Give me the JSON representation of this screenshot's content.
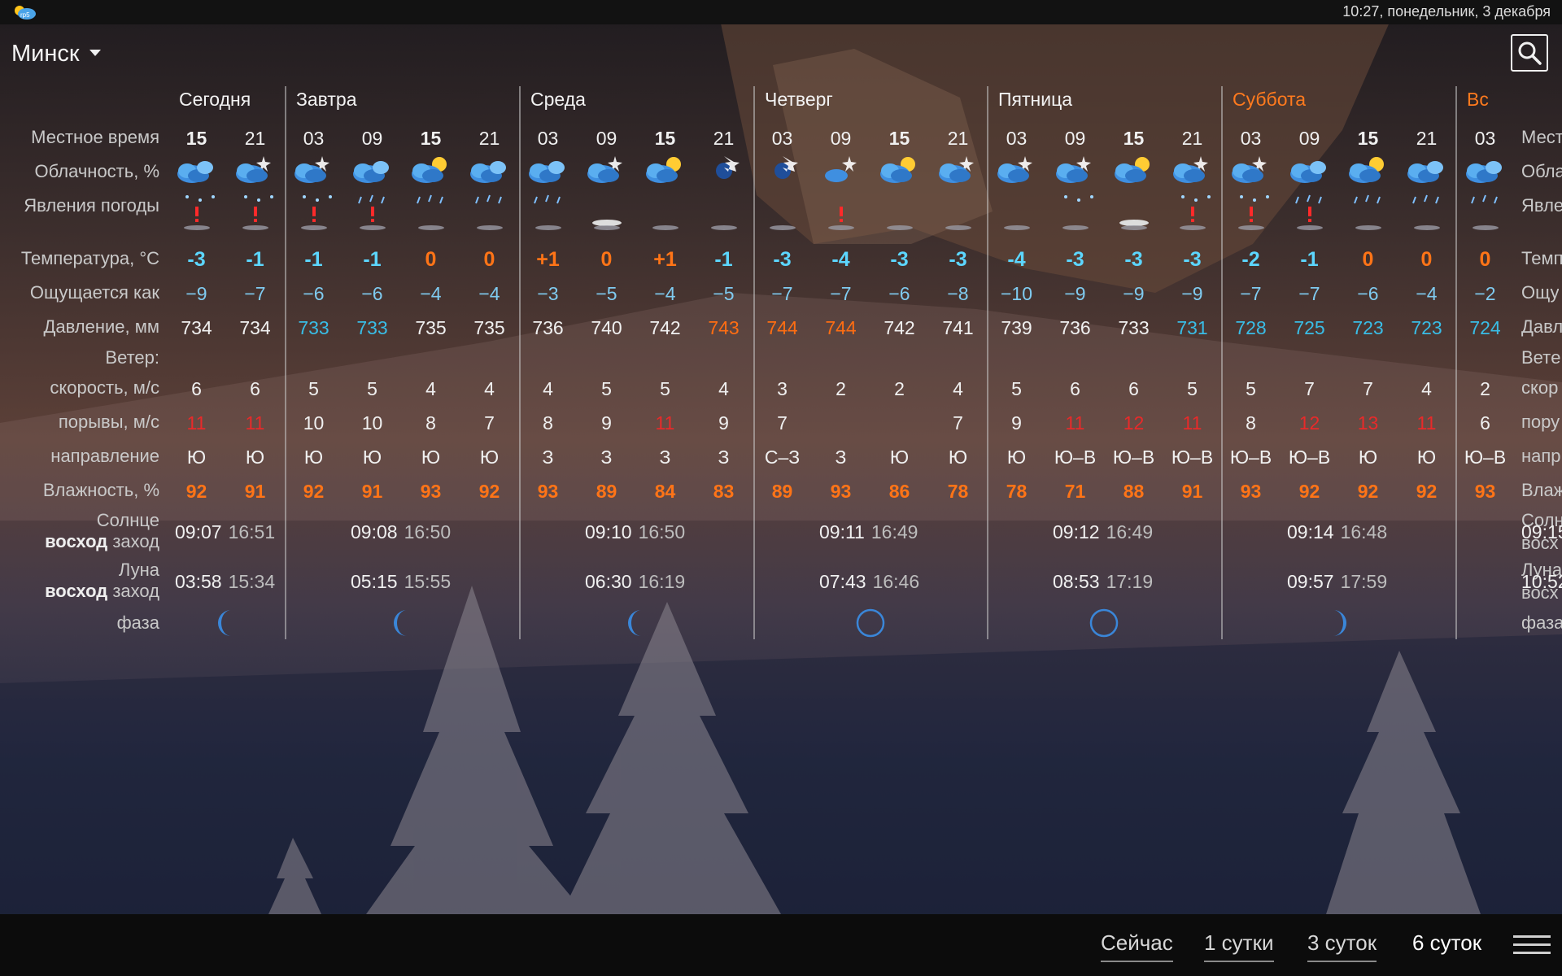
{
  "status": {
    "time": "10:27, понедельник, 3 декабря",
    "app_icon": "weather-app-icon"
  },
  "header": {
    "city": "Минск",
    "search_icon": "search-icon"
  },
  "labels": {
    "local_time": "Местное время",
    "cloudiness": "Облачность, %",
    "phenomena": "Явления погоды",
    "temperature": "Температура, °C",
    "feels_like": "Ощущается как",
    "pressure": "Давление, мм",
    "wind": "Ветер:",
    "wind_speed": "скорость, м/с",
    "gusts": "порывы, м/с",
    "direction": "направление",
    "humidity": "Влажность, %",
    "sun": "Солнце",
    "moon": "Луна",
    "rise": "восход",
    "set": "заход",
    "phase": "фаза"
  },
  "right_labels": {
    "local_time": "Мест",
    "cloudiness": "Обла",
    "phenomena": "Явле",
    "temperature": "Темп",
    "feels_like": "Ощу",
    "pressure": "Давл",
    "wind": "Ветe",
    "wind_speed": "скор",
    "gusts": "пору",
    "direction": "напр",
    "humidity": "Влаж",
    "sun": "Солн",
    "rise": "восх",
    "moon": "Луна",
    "moon_rise": "восх",
    "phase": "фаза"
  },
  "days": [
    {
      "name": "Сегодня",
      "weekend": false,
      "sun_rise": "09:07",
      "sun_set": "16:51",
      "moon_rise": "03:58",
      "moon_set": "15:34",
      "phase": "waning-crescent"
    },
    {
      "name": "Завтра",
      "weekend": false,
      "sun_rise": "09:08",
      "sun_set": "16:50",
      "moon_rise": "05:15",
      "moon_set": "15:55",
      "phase": "waning-crescent"
    },
    {
      "name": "Среда",
      "weekend": false,
      "sun_rise": "09:10",
      "sun_set": "16:50",
      "moon_rise": "06:30",
      "moon_set": "16:19",
      "phase": "waning-crescent-thin"
    },
    {
      "name": "Четверг",
      "weekend": false,
      "sun_rise": "09:11",
      "sun_set": "16:49",
      "moon_rise": "07:43",
      "moon_set": "16:46",
      "phase": "new-moon"
    },
    {
      "name": "Пятница",
      "weekend": false,
      "sun_rise": "09:12",
      "sun_set": "16:49",
      "moon_rise": "08:53",
      "moon_set": "17:19",
      "phase": "new-moon"
    },
    {
      "name": "Суббота",
      "weekend": true,
      "sun_rise": "09:14",
      "sun_set": "16:48",
      "moon_rise": "09:57",
      "moon_set": "17:59",
      "phase": "waxing-crescent"
    },
    {
      "name": "Вс",
      "weekend": true,
      "sun_rise": "09:15",
      "sun_set": "",
      "moon_rise": "10:52",
      "moon_set": "",
      "phase": "waxing-crescent"
    }
  ],
  "slots": [
    {
      "time": "15",
      "noon": true,
      "cloud": "cloudy",
      "phen": "light-snow",
      "warn": true,
      "temp": "-3",
      "tclass": "cold",
      "feels": "−9",
      "pres": "734",
      "pclass": "",
      "wind": "6",
      "gust": "11",
      "gstrong": true,
      "dir": "Ю",
      "hum": "92"
    },
    {
      "time": "21",
      "noon": false,
      "cloud": "cloudy-night",
      "phen": "light-snow",
      "warn": true,
      "temp": "-1",
      "tclass": "cold",
      "feels": "−7",
      "pres": "734",
      "pclass": "",
      "wind": "6",
      "gust": "11",
      "gstrong": true,
      "dir": "Ю",
      "hum": "91"
    },
    {
      "time": "03",
      "noon": false,
      "cloud": "cloudy-night",
      "phen": "light-snow",
      "warn": true,
      "temp": "-1",
      "tclass": "cold",
      "feels": "−6",
      "pres": "733",
      "pclass": "low",
      "wind": "5",
      "gust": "10",
      "gstrong": false,
      "dir": "Ю",
      "hum": "92"
    },
    {
      "time": "09",
      "noon": false,
      "cloud": "cloudy",
      "phen": "light-rain",
      "warn": true,
      "temp": "-1",
      "tclass": "cold",
      "feels": "−6",
      "pres": "733",
      "pclass": "low",
      "wind": "5",
      "gust": "10",
      "gstrong": false,
      "dir": "Ю",
      "hum": "91"
    },
    {
      "time": "15",
      "noon": true,
      "cloud": "partly-sunny",
      "phen": "light-rain",
      "warn": false,
      "temp": "0",
      "tclass": "warm",
      "feels": "−4",
      "pres": "735",
      "pclass": "",
      "wind": "4",
      "gust": "8",
      "gstrong": false,
      "dir": "Ю",
      "hum": "93"
    },
    {
      "time": "21",
      "noon": false,
      "cloud": "cloudy",
      "phen": "light-rain",
      "warn": false,
      "temp": "0",
      "tclass": "warm",
      "feels": "−4",
      "pres": "735",
      "pclass": "",
      "wind": "4",
      "gust": "7",
      "gstrong": false,
      "dir": "Ю",
      "hum": "92"
    },
    {
      "time": "03",
      "noon": false,
      "cloud": "cloudy",
      "phen": "light-rain",
      "warn": false,
      "temp": "+1",
      "tclass": "warm",
      "feels": "−3",
      "pres": "736",
      "pclass": "",
      "wind": "4",
      "gust": "8",
      "gstrong": false,
      "dir": "З",
      "hum": "93"
    },
    {
      "time": "09",
      "noon": false,
      "cloud": "cloudy-night",
      "phen": "fog",
      "warn": false,
      "temp": "0",
      "tclass": "warm",
      "feels": "−5",
      "pres": "740",
      "pclass": "",
      "wind": "5",
      "gust": "9",
      "gstrong": false,
      "dir": "З",
      "hum": "89"
    },
    {
      "time": "15",
      "noon": true,
      "cloud": "partly-sunny",
      "phen": "",
      "warn": false,
      "temp": "+1",
      "tclass": "warm",
      "feels": "−4",
      "pres": "742",
      "pclass": "",
      "wind": "5",
      "gust": "11",
      "gstrong": true,
      "dir": "З",
      "hum": "84"
    },
    {
      "time": "21",
      "noon": false,
      "cloud": "clear-night",
      "phen": "",
      "warn": false,
      "temp": "-1",
      "tclass": "cold",
      "feels": "−5",
      "pres": "743",
      "pclass": "high",
      "wind": "4",
      "gust": "9",
      "gstrong": false,
      "dir": "З",
      "hum": "83"
    },
    {
      "time": "03",
      "noon": false,
      "cloud": "clear-night",
      "phen": "",
      "warn": false,
      "temp": "-3",
      "tclass": "cold",
      "feels": "−7",
      "pres": "744",
      "pclass": "high",
      "wind": "3",
      "gust": "7",
      "gstrong": false,
      "dir": "С–З",
      "hum": "89"
    },
    {
      "time": "09",
      "noon": false,
      "cloud": "partly-clear-night",
      "phen": "warn-only",
      "warn": true,
      "temp": "-4",
      "tclass": "cold",
      "feels": "−7",
      "pres": "744",
      "pclass": "high",
      "wind": "2",
      "gust": "",
      "gstrong": false,
      "dir": "З",
      "hum": "93"
    },
    {
      "time": "15",
      "noon": true,
      "cloud": "partly-sunny",
      "phen": "",
      "warn": false,
      "temp": "-3",
      "tclass": "cold",
      "feels": "−6",
      "pres": "742",
      "pclass": "",
      "wind": "2",
      "gust": "",
      "gstrong": false,
      "dir": "Ю",
      "hum": "86"
    },
    {
      "time": "21",
      "noon": false,
      "cloud": "cloudy-night",
      "phen": "",
      "warn": false,
      "temp": "-3",
      "tclass": "cold",
      "feels": "−8",
      "pres": "741",
      "pclass": "",
      "wind": "4",
      "gust": "7",
      "gstrong": false,
      "dir": "Ю",
      "hum": "78"
    },
    {
      "time": "03",
      "noon": false,
      "cloud": "cloudy-night",
      "phen": "",
      "warn": false,
      "temp": "-4",
      "tclass": "cold",
      "feels": "−10",
      "pres": "739",
      "pclass": "",
      "wind": "5",
      "gust": "9",
      "gstrong": false,
      "dir": "Ю",
      "hum": "78"
    },
    {
      "time": "09",
      "noon": false,
      "cloud": "cloudy-night",
      "phen": "snow-flakes",
      "warn": false,
      "temp": "-3",
      "tclass": "cold",
      "feels": "−9",
      "pres": "736",
      "pclass": "",
      "wind": "6",
      "gust": "11",
      "gstrong": true,
      "dir": "Ю–В",
      "hum": "71"
    },
    {
      "time": "15",
      "noon": true,
      "cloud": "cloudy-sun",
      "phen": "fog",
      "warn": false,
      "temp": "-3",
      "tclass": "cold",
      "feels": "−9",
      "pres": "733",
      "pclass": "",
      "wind": "6",
      "gust": "12",
      "gstrong": true,
      "dir": "Ю–В",
      "hum": "88"
    },
    {
      "time": "21",
      "noon": false,
      "cloud": "cloudy-night",
      "phen": "snow-flakes",
      "warn": true,
      "temp": "-3",
      "tclass": "cold",
      "feels": "−9",
      "pres": "731",
      "pclass": "low",
      "wind": "5",
      "gust": "11",
      "gstrong": true,
      "dir": "Ю–В",
      "hum": "91"
    },
    {
      "time": "03",
      "noon": false,
      "cloud": "cloudy-night",
      "phen": "snow-flakes",
      "warn": true,
      "temp": "-2",
      "tclass": "cold",
      "feels": "−7",
      "pres": "728",
      "pclass": "low",
      "wind": "5",
      "gust": "8",
      "gstrong": false,
      "dir": "Ю–В",
      "hum": "93"
    },
    {
      "time": "09",
      "noon": false,
      "cloud": "cloudy",
      "phen": "snow-rain",
      "warn": true,
      "temp": "-1",
      "tclass": "cold",
      "feels": "−7",
      "pres": "725",
      "pclass": "low",
      "wind": "7",
      "gust": "12",
      "gstrong": true,
      "dir": "Ю–В",
      "hum": "92"
    },
    {
      "time": "15",
      "noon": true,
      "cloud": "cloudy-sun",
      "phen": "snow-rain",
      "warn": false,
      "temp": "0",
      "tclass": "warm",
      "feels": "−6",
      "pres": "723",
      "pclass": "low",
      "wind": "7",
      "gust": "13",
      "gstrong": true,
      "dir": "Ю",
      "hum": "92"
    },
    {
      "time": "21",
      "noon": false,
      "cloud": "cloudy",
      "phen": "light-rain",
      "warn": false,
      "temp": "0",
      "tclass": "warm",
      "feels": "−4",
      "pres": "723",
      "pclass": "low",
      "wind": "4",
      "gust": "11",
      "gstrong": true,
      "dir": "Ю",
      "hum": "92"
    },
    {
      "time": "03",
      "noon": false,
      "cloud": "cloudy",
      "phen": "light-rain",
      "warn": false,
      "temp": "0",
      "tclass": "warm",
      "feels": "−2",
      "pres": "724",
      "pclass": "low",
      "wind": "2",
      "gust": "6",
      "gstrong": false,
      "dir": "Ю–В",
      "hum": "93"
    }
  ],
  "tabs": [
    {
      "label": "Сейчас",
      "active": false
    },
    {
      "label": "1 сутки",
      "active": false
    },
    {
      "label": "3 суток",
      "active": false
    },
    {
      "label": "6 суток",
      "active": true
    }
  ],
  "menu_icon": "hamburger-menu-icon"
}
